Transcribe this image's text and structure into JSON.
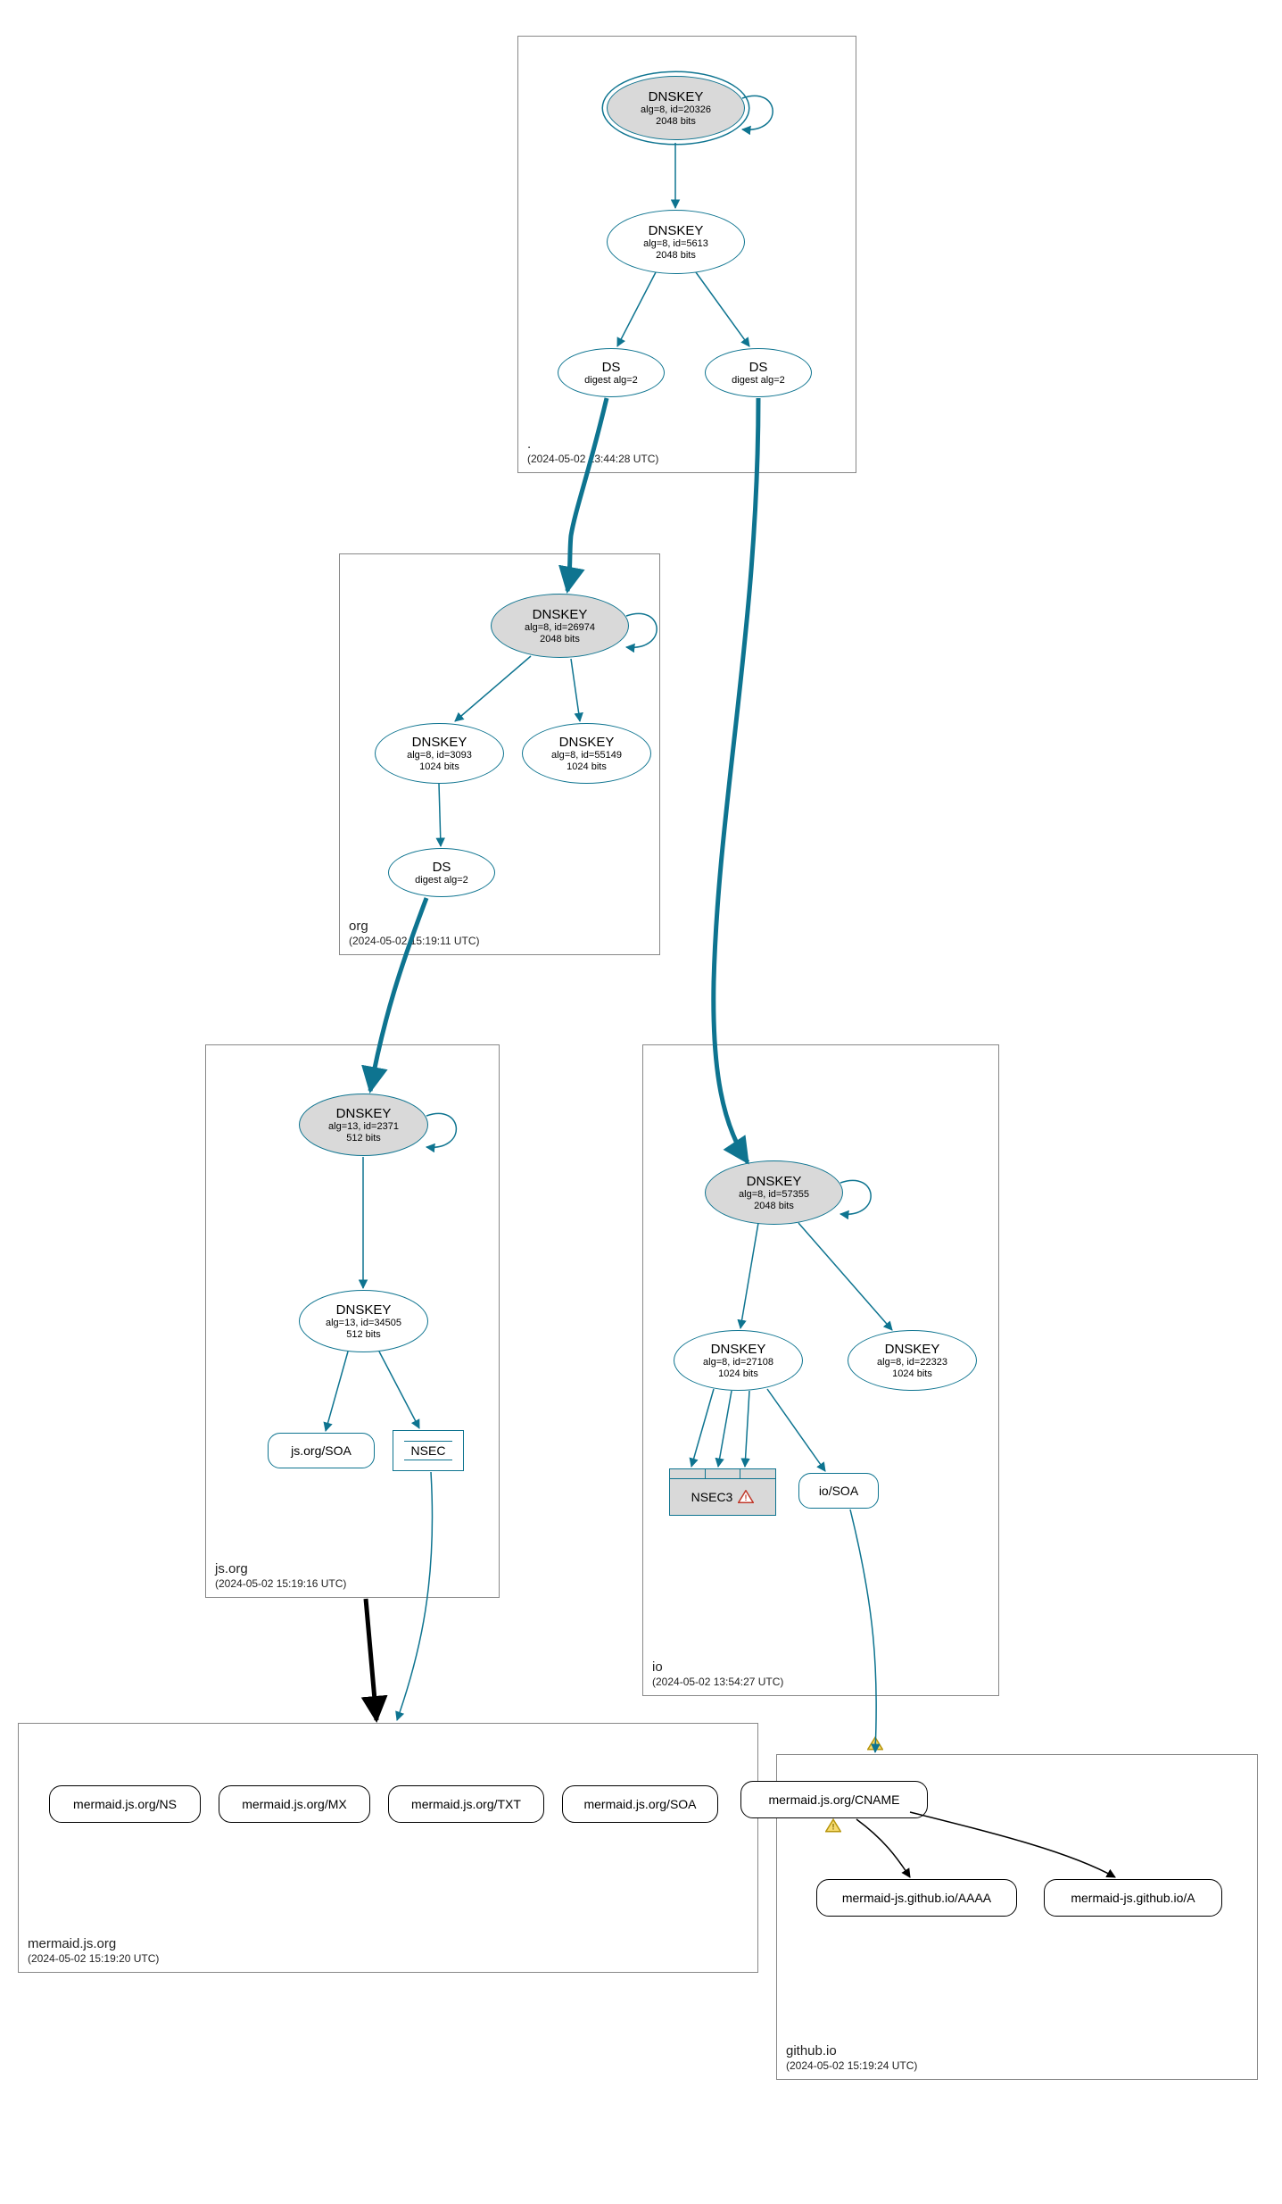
{
  "zones": {
    "root": {
      "name": ".",
      "time": "(2024-05-02 13:44:28 UTC)"
    },
    "org": {
      "name": "org",
      "time": "(2024-05-02 15:19:11 UTC)"
    },
    "jsorg": {
      "name": "js.org",
      "time": "(2024-05-02 15:19:16 UTC)"
    },
    "mermaid": {
      "name": "mermaid.js.org",
      "time": "(2024-05-02 15:19:20 UTC)"
    },
    "io": {
      "name": "io",
      "time": "(2024-05-02 13:54:27 UTC)"
    },
    "github": {
      "name": "github.io",
      "time": "(2024-05-02 15:19:24 UTC)"
    }
  },
  "nodes": {
    "root_ksk": {
      "l1": "DNSKEY",
      "l2": "alg=8, id=20326",
      "l3": "2048 bits"
    },
    "root_zsk": {
      "l1": "DNSKEY",
      "l2": "alg=8, id=5613",
      "l3": "2048 bits"
    },
    "root_ds1": {
      "l1": "DS",
      "l2": "digest alg=2"
    },
    "root_ds2": {
      "l1": "DS",
      "l2": "digest alg=2"
    },
    "org_ksk": {
      "l1": "DNSKEY",
      "l2": "alg=8, id=26974",
      "l3": "2048 bits"
    },
    "org_zsk1": {
      "l1": "DNSKEY",
      "l2": "alg=8, id=3093",
      "l3": "1024 bits"
    },
    "org_zsk2": {
      "l1": "DNSKEY",
      "l2": "alg=8, id=55149",
      "l3": "1024 bits"
    },
    "org_ds": {
      "l1": "DS",
      "l2": "digest alg=2"
    },
    "jsorg_ksk": {
      "l1": "DNSKEY",
      "l2": "alg=13, id=2371",
      "l3": "512 bits"
    },
    "jsorg_zsk": {
      "l1": "DNSKEY",
      "l2": "alg=13, id=34505",
      "l3": "512 bits"
    },
    "jsorg_soa": "js.org/SOA",
    "jsorg_nsec": "NSEC",
    "io_ksk": {
      "l1": "DNSKEY",
      "l2": "alg=8, id=57355",
      "l3": "2048 bits"
    },
    "io_zsk1": {
      "l1": "DNSKEY",
      "l2": "alg=8, id=27108",
      "l3": "1024 bits"
    },
    "io_zsk2": {
      "l1": "DNSKEY",
      "l2": "alg=8, id=22323",
      "l3": "1024 bits"
    },
    "io_nsec3": "NSEC3",
    "io_soa": "io/SOA",
    "m_ns": "mermaid.js.org/NS",
    "m_mx": "mermaid.js.org/MX",
    "m_txt": "mermaid.js.org/TXT",
    "m_soa": "mermaid.js.org/SOA",
    "m_cname": "mermaid.js.org/CNAME",
    "gh_aaaa": "mermaid-js.github.io/AAAA",
    "gh_a": "mermaid-js.github.io/A"
  },
  "colors": {
    "teal": "#0e7490",
    "black": "#000000",
    "grey_fill": "#d9d9d9"
  }
}
